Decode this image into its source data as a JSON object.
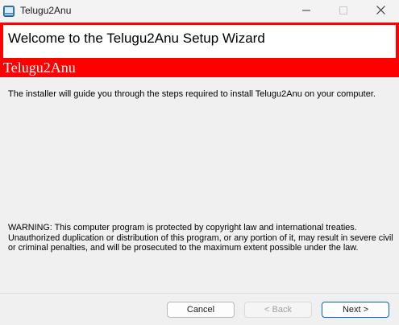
{
  "window": {
    "title": "Telugu2Anu"
  },
  "header": {
    "title": "Welcome to the Telugu2Anu Setup Wizard",
    "brand": "Telugu2Anu"
  },
  "body": {
    "intro": "The installer will guide you through the steps required to install Telugu2Anu on your computer.",
    "warning": "WARNING: This computer program is protected by copyright law and international treaties. Unauthorized duplication or distribution of this program, or any portion of it, may result in severe civil or criminal penalties, and will be prosecuted to the maximum extent possible under the law."
  },
  "buttons": {
    "cancel": "Cancel",
    "back": "< Back",
    "next": "Next >"
  },
  "colors": {
    "header_accent": "#ff0000",
    "focus_border": "#0067c0"
  },
  "icons": {
    "app": "installer-icon",
    "minimize": "minimize-icon",
    "maximize": "maximize-icon",
    "close": "close-icon"
  }
}
